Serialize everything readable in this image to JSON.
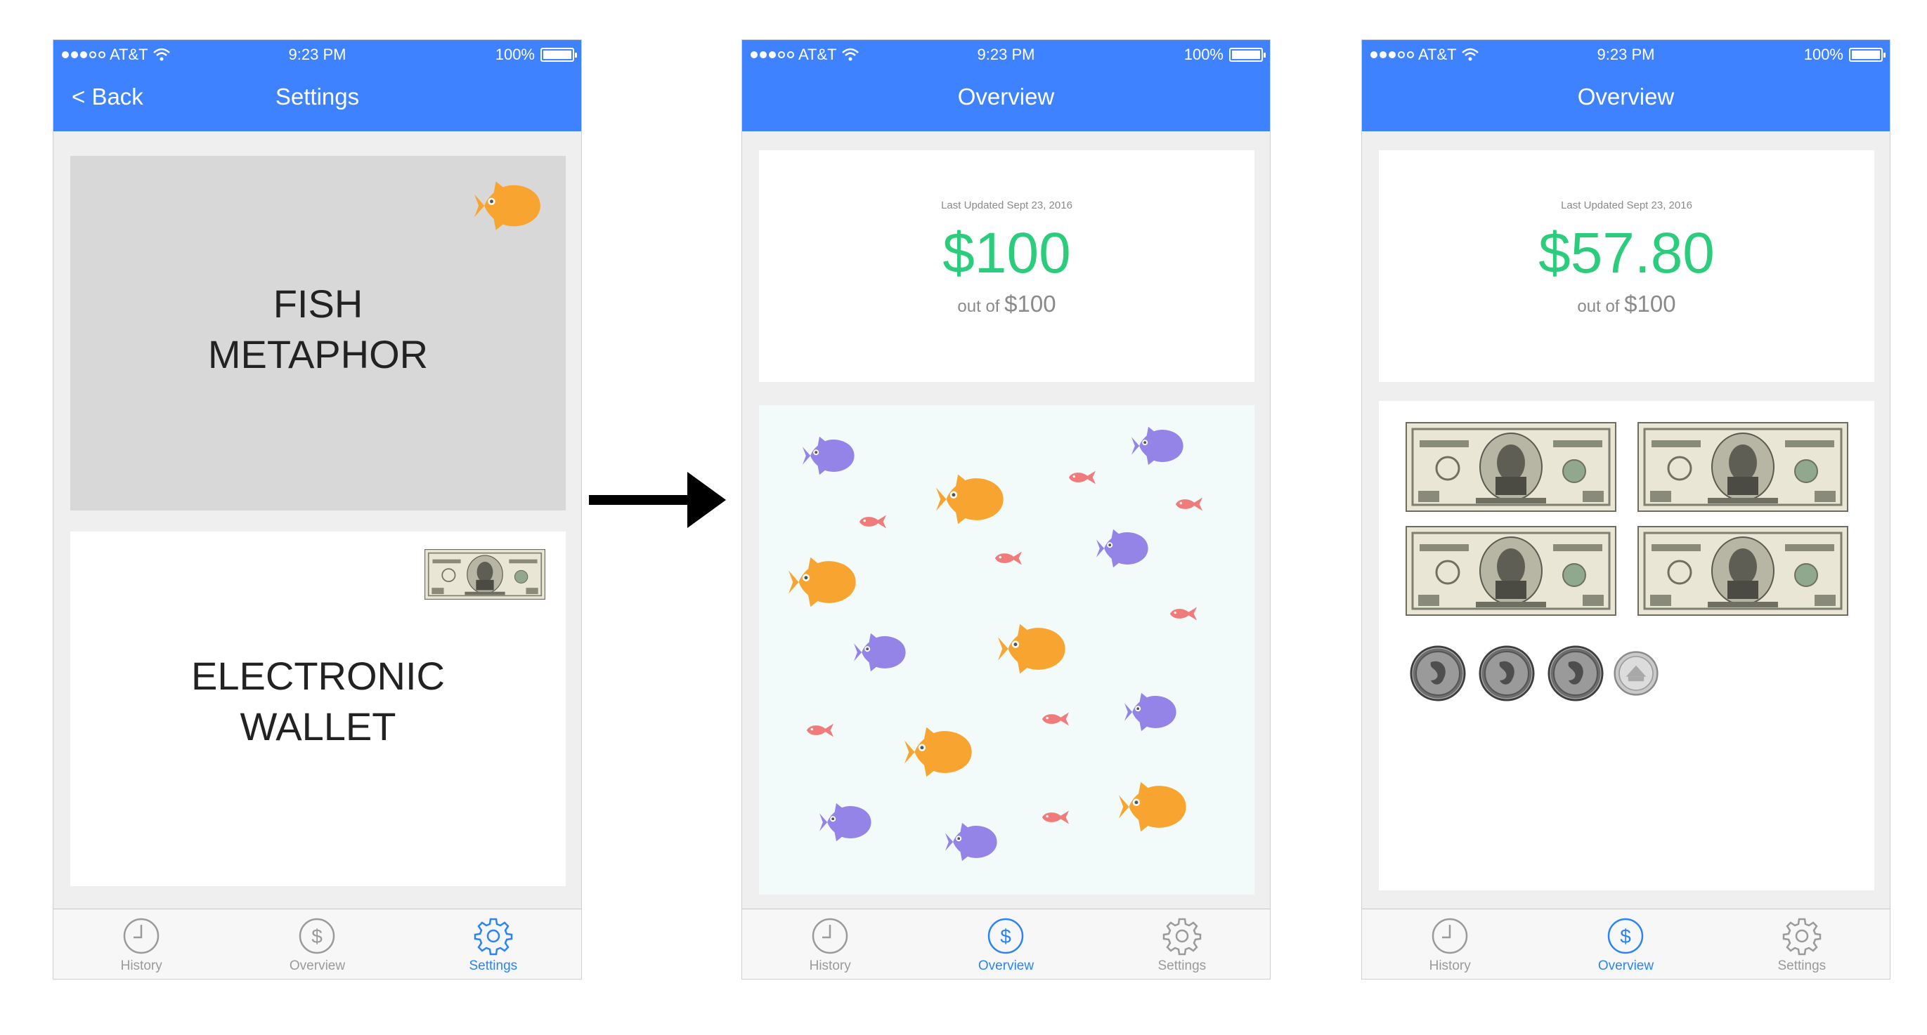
{
  "status_bar": {
    "carrier": "AT&T",
    "time": "9:23 PM",
    "battery": "100%"
  },
  "screen1": {
    "back_label": "< Back",
    "title": "Settings",
    "options": [
      {
        "line1": "FISH",
        "line2": "METAPHOR",
        "icon": "fish-icon"
      },
      {
        "line1": "ELECTRONIC",
        "line2": "WALLET",
        "icon": "five-dollar-bill"
      }
    ]
  },
  "screen2": {
    "title": "Overview",
    "last_updated": "Last Updated Sept 23, 2016",
    "amount": "$100",
    "out_of_prefix": "out of",
    "out_of_value": "$100"
  },
  "screen3": {
    "title": "Overview",
    "last_updated": "Last Updated Sept 23, 2016",
    "amount": "$57.80",
    "out_of_prefix": "out of",
    "out_of_value": "$100",
    "bills": [
      "$50",
      "$5",
      "$1",
      "$1"
    ],
    "coins": [
      "quarter",
      "quarter",
      "quarter",
      "nickel"
    ]
  },
  "tabs": [
    {
      "label": "History",
      "icon": "clock-icon"
    },
    {
      "label": "Overview",
      "icon": "dollar-circle-icon"
    },
    {
      "label": "Settings",
      "icon": "gear-icon"
    }
  ],
  "colors": {
    "nav_blue": "#3f82ff",
    "amount_green": "#2bcc7c",
    "active_tab": "#2b84f5",
    "fish_orange": "#f7a530",
    "fish_purple": "#9584e8",
    "fish_red": "#ef7b7b"
  }
}
